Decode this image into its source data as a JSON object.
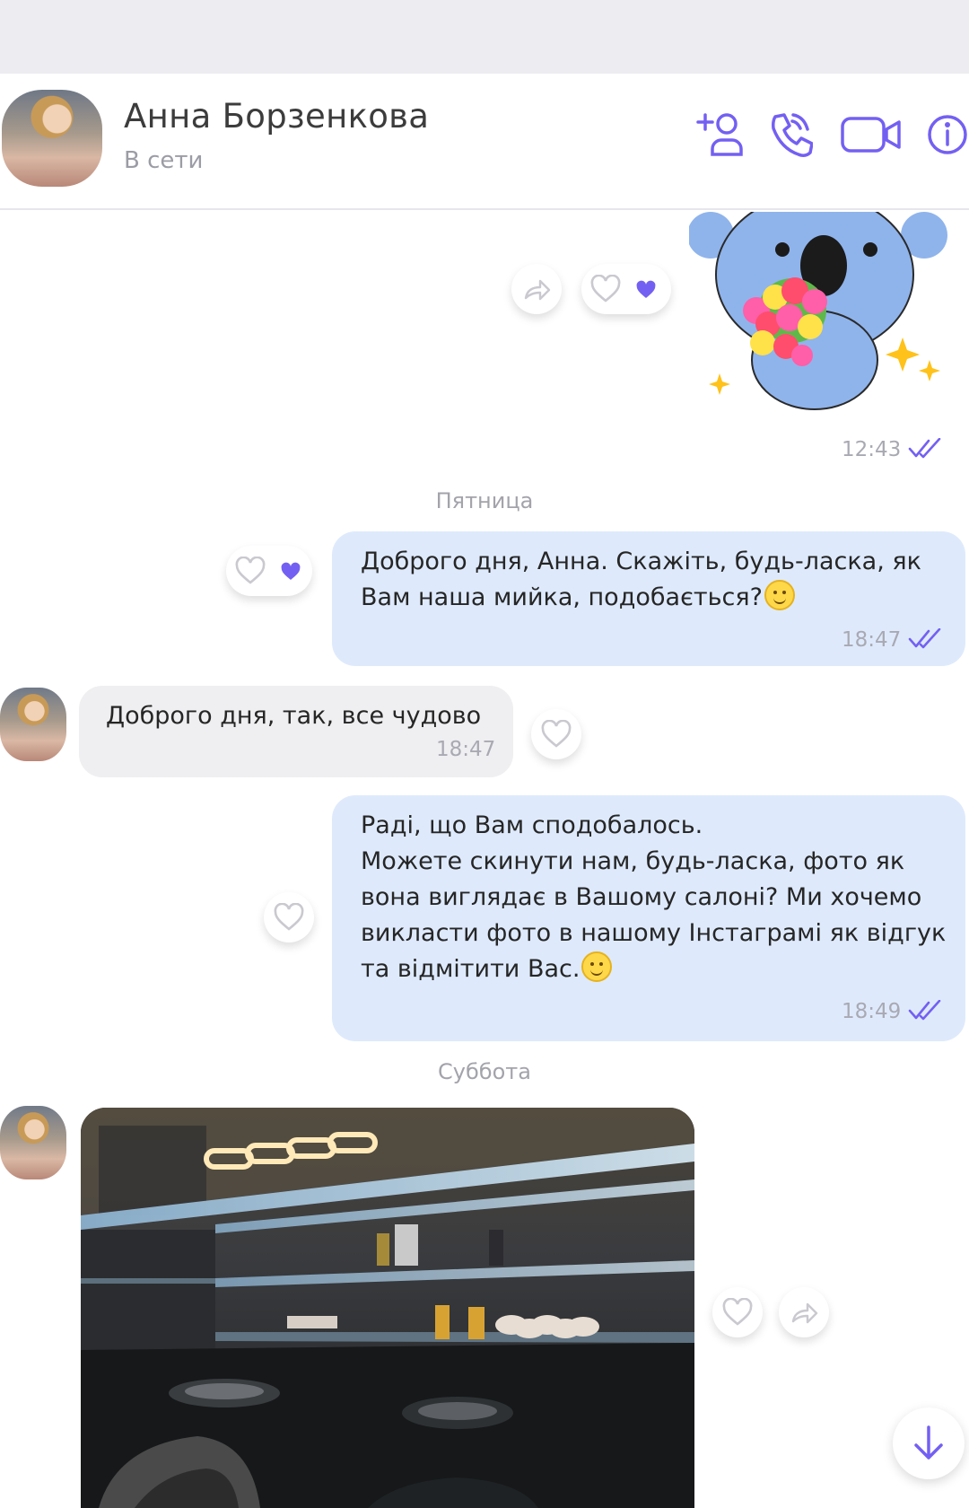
{
  "contact": {
    "name": "Анна Борзенкова",
    "status": "В сети"
  },
  "header_icons": [
    "add-contact-icon",
    "phone-icon",
    "video-icon",
    "info-icon"
  ],
  "colors": {
    "accent": "#7360f2",
    "outgoing_bubble": "#deeafc",
    "incoming_bubble": "#efeff1",
    "heart_filled": "#7360f2"
  },
  "messages": [
    {
      "type": "sticker",
      "direction": "out",
      "time": "12:43",
      "read": true,
      "reactions": "liked"
    },
    {
      "type": "day_separator",
      "label": "Пятница"
    },
    {
      "type": "text",
      "direction": "out",
      "text": "Доброго дня, Анна. Скажіть, будь-ласка, як\nВам наша мийка, подобається?",
      "emoji": "smile",
      "time": "18:47",
      "read": true,
      "reactions": "liked"
    },
    {
      "type": "text",
      "direction": "in",
      "text": "Доброго дня, так, все чудово",
      "time": "18:47"
    },
    {
      "type": "text",
      "direction": "out",
      "text": "Раді, що Вам сподобалось.\nМожете скинути нам, будь-ласка, фото як\nвона виглядає в Вашому салоні? Ми хочемо\nвикласти фото в нашому Інстаграмі як відгук\nта відмітити Вас.",
      "emoji": "smile",
      "time": "18:49",
      "read": true
    },
    {
      "type": "day_separator",
      "label": "Суббота"
    },
    {
      "type": "photo",
      "direction": "in"
    }
  ]
}
